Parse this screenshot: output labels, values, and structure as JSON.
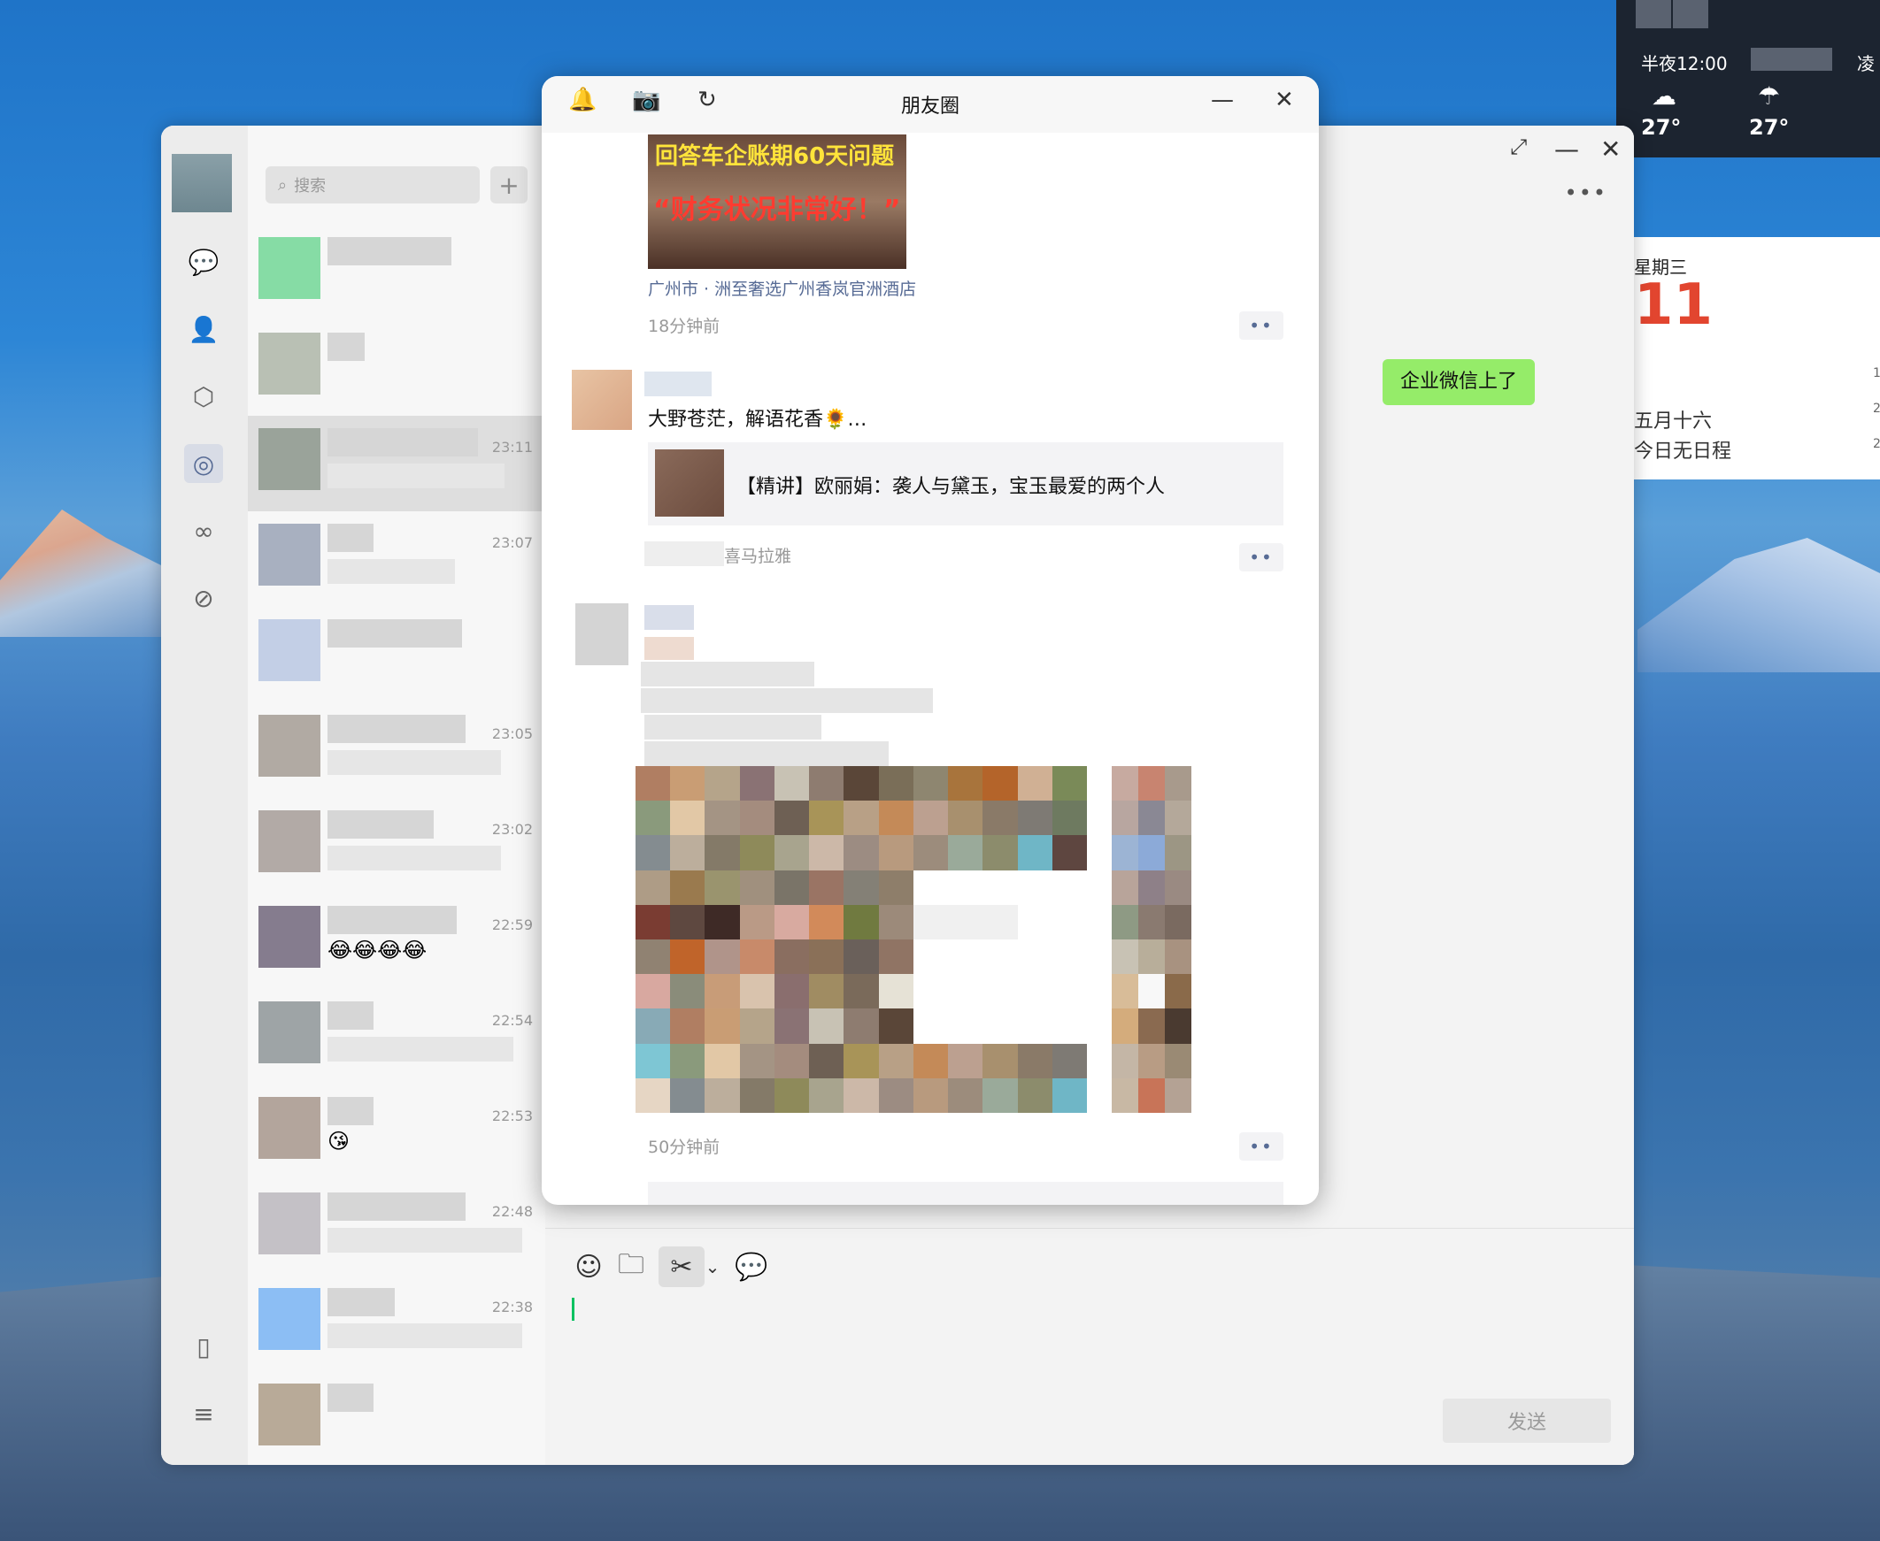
{
  "desktop": {
    "weather": {
      "time_label": "半夜12:00",
      "next_label": "凌",
      "temp1": "27°",
      "temp2": "27°",
      "icon1": "☁",
      "icon2": "☂"
    },
    "calendar": {
      "weekday": "星期三",
      "day": "11",
      "lunar": "五月十六",
      "schedule": "今日无日程",
      "side_marks": [
        "1",
        "2",
        "2"
      ]
    }
  },
  "wechat": {
    "search_placeholder": "搜索",
    "add_icon": "+",
    "nav": {
      "chat_icon": "💬",
      "contacts_icon": "👤",
      "favorites_icon": "⬡",
      "moments_icon": "◎",
      "channels_icon": "∞",
      "miniprogram_icon": "⊘",
      "phone_icon": "▯",
      "menu_icon": "≡"
    },
    "chats": [
      {
        "time": "",
        "avatar": "#86dca5"
      },
      {
        "time": "",
        "avatar": "#b9c0b4"
      },
      {
        "time": "23:11",
        "avatar": "#9aa39a"
      },
      {
        "time": "23:07",
        "avatar": "#a8b0c0"
      },
      {
        "time": "",
        "avatar": "#c3cfe6"
      },
      {
        "time": "23:05",
        "avatar": "#b1aaa3"
      },
      {
        "time": "23:02",
        "avatar": "#b2aaa6"
      },
      {
        "time": "22:59",
        "avatar": "#857c8e",
        "emoji": "😂😂😂😂"
      },
      {
        "time": "22:54",
        "avatar": "#9ea4a6"
      },
      {
        "time": "22:53",
        "avatar": "#b3a59c",
        "emoji": "😘"
      },
      {
        "time": "22:48",
        "avatar": "#c4c1c6"
      },
      {
        "time": "22:38",
        "avatar": "#8cbef4"
      },
      {
        "time": "",
        "avatar": "#b8aa98"
      }
    ],
    "chat": {
      "message": "企业微信上了",
      "more_icon": "•••",
      "restore_icon": "⤢",
      "minimize_icon": "—",
      "close_icon": "✕"
    },
    "toolbar": {
      "emoji_icon": "☺",
      "folder_icon": "🗀",
      "scissors_icon": "✂",
      "dropdown_icon": "⌄",
      "chat_bubble_icon": "💬"
    },
    "send_label": "发送"
  },
  "moments": {
    "title": "朋友圈",
    "bell_icon": "🔔",
    "camera_icon": "📷",
    "refresh_icon": "↻",
    "minimize_icon": "—",
    "close_icon": "✕",
    "post1": {
      "image_line1": "回答车企账期60天问题",
      "image_line2": "“财务状况非常好！”",
      "location": "广州市 · 洲至奢选广州香岚官洲酒店",
      "time": "18分钟前"
    },
    "post2": {
      "text": "大野苍茫，解语花香🌻…",
      "share_title": "【精讲】欧丽娟：袭人与黛玉，宝玉最爱的两个人",
      "source": "喜马拉雅"
    },
    "post3": {
      "time": "50分钟前"
    },
    "more_dots": "••"
  }
}
